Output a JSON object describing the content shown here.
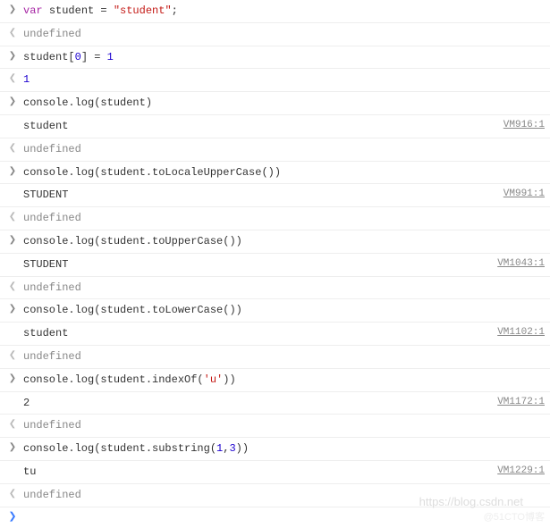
{
  "arrows": {
    "in": "❯",
    "out": "❮"
  },
  "undef": "undefined",
  "entries": [
    {
      "input_tokens": [
        {
          "t": "var ",
          "c": "k-var"
        },
        {
          "t": "student ",
          "c": "k-ident"
        },
        {
          "t": "= ",
          "c": "k-op"
        },
        {
          "t": "\"student\"",
          "c": "k-str"
        },
        {
          "t": ";",
          "c": "k-op"
        }
      ],
      "logs": [],
      "return_undef": true
    },
    {
      "input_tokens": [
        {
          "t": "student[",
          "c": "k-ident"
        },
        {
          "t": "0",
          "c": "k-num"
        },
        {
          "t": "] = ",
          "c": "k-ident"
        },
        {
          "t": "1",
          "c": "k-num"
        }
      ],
      "logs": [],
      "return_text": "1",
      "return_class": "k-num"
    },
    {
      "input_tokens": [
        {
          "t": "console.log(student)",
          "c": "k-ident"
        }
      ],
      "logs": [
        {
          "text": "student",
          "src": "VM916:1"
        }
      ],
      "return_undef": true
    },
    {
      "input_tokens": [
        {
          "t": "console.log(student.toLocaleUpperCase())",
          "c": "k-ident"
        }
      ],
      "logs": [
        {
          "text": "STUDENT",
          "src": "VM991:1"
        }
      ],
      "return_undef": true
    },
    {
      "input_tokens": [
        {
          "t": "console.log(student.toUpperCase())",
          "c": "k-ident"
        }
      ],
      "logs": [
        {
          "text": "STUDENT",
          "src": "VM1043:1"
        }
      ],
      "return_undef": true
    },
    {
      "input_tokens": [
        {
          "t": "console.log(student.toLowerCase())",
          "c": "k-ident"
        }
      ],
      "logs": [
        {
          "text": "student",
          "src": "VM1102:1"
        }
      ],
      "return_undef": true
    },
    {
      "input_tokens": [
        {
          "t": "console.log(student.indexOf(",
          "c": "k-ident"
        },
        {
          "t": "'u'",
          "c": "k-str"
        },
        {
          "t": "))",
          "c": "k-ident"
        }
      ],
      "logs": [
        {
          "text": "2",
          "src": "VM1172:1"
        }
      ],
      "return_undef": true
    },
    {
      "input_tokens": [
        {
          "t": "console.log(student.substring(",
          "c": "k-ident"
        },
        {
          "t": "1",
          "c": "k-num"
        },
        {
          "t": ",",
          "c": "k-ident"
        },
        {
          "t": "3",
          "c": "k-num"
        },
        {
          "t": "))",
          "c": "k-ident"
        }
      ],
      "logs": [
        {
          "text": "tu",
          "src": "VM1229:1"
        }
      ],
      "return_undef": true
    }
  ],
  "watermark1": "https://blog.csdn.net",
  "watermark2": "@51CTO博客"
}
